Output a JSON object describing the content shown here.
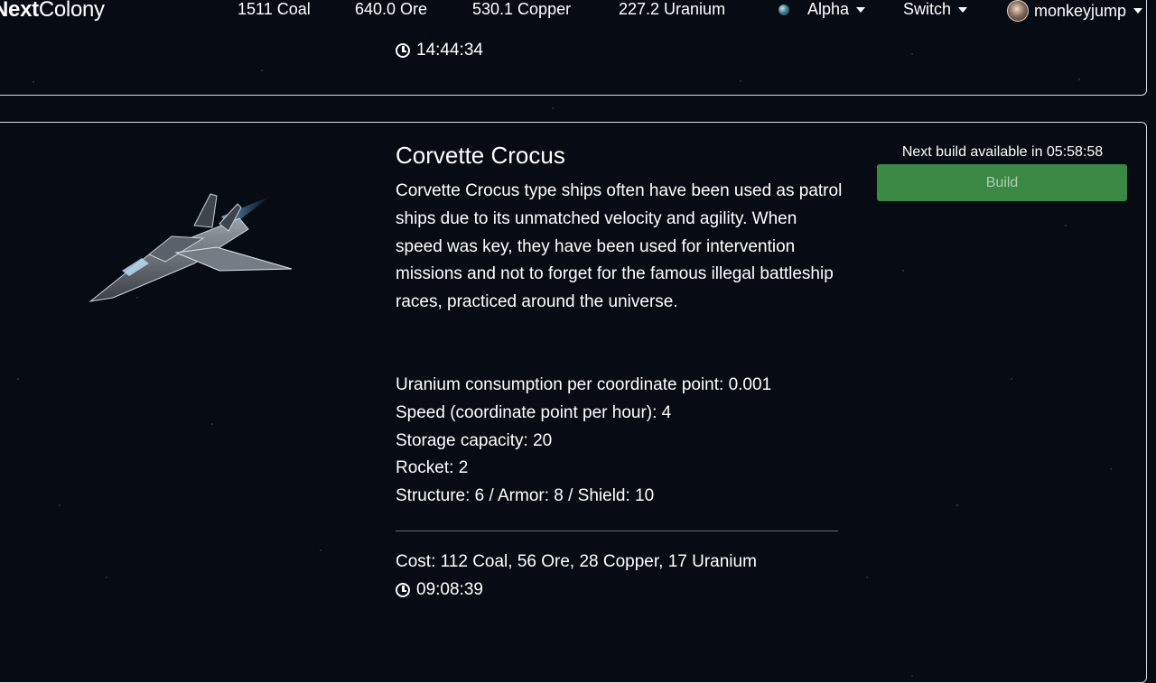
{
  "brand": {
    "part1": "Next",
    "part2": "Colony"
  },
  "resources": [
    {
      "label": "1511 Coal"
    },
    {
      "label": "640.0 Ore"
    },
    {
      "label": "530.1 Copper"
    },
    {
      "label": "227.2 Uranium"
    }
  ],
  "nav": {
    "planet_label": "Alpha",
    "switch_label": "Switch",
    "user_label": "monkeyjump"
  },
  "previous_card": {
    "timer": "14:44:34"
  },
  "ship": {
    "title": "Corvette Crocus",
    "description": "Corvette Crocus type ships often have been used as patrol ships due to its unmatched velocity and agility. When speed was key, they have been used for intervention missions and not to forget for the famous illegal battleship races, practiced around the universe.",
    "stats": [
      "Uranium consumption per coordinate point: 0.001",
      "Speed (coordinate point per hour): 4",
      "Storage capacity: 20",
      "Rocket: 2",
      "Structure: 6 / Armor: 8 / Shield: 10"
    ],
    "cost": "Cost: 112 Coal, 56 Ore, 28 Copper, 17 Uranium",
    "build_time": "09:08:39",
    "next_build": "Next build available in 05:58:58",
    "build_label": "Build"
  },
  "colors": {
    "background": "#070b14",
    "panel_border": "#d9dde6",
    "build_button": "#3f8f48"
  },
  "icons": {
    "clock": "clock-icon",
    "caret": "caret-down-icon",
    "planet": "planet-icon"
  }
}
